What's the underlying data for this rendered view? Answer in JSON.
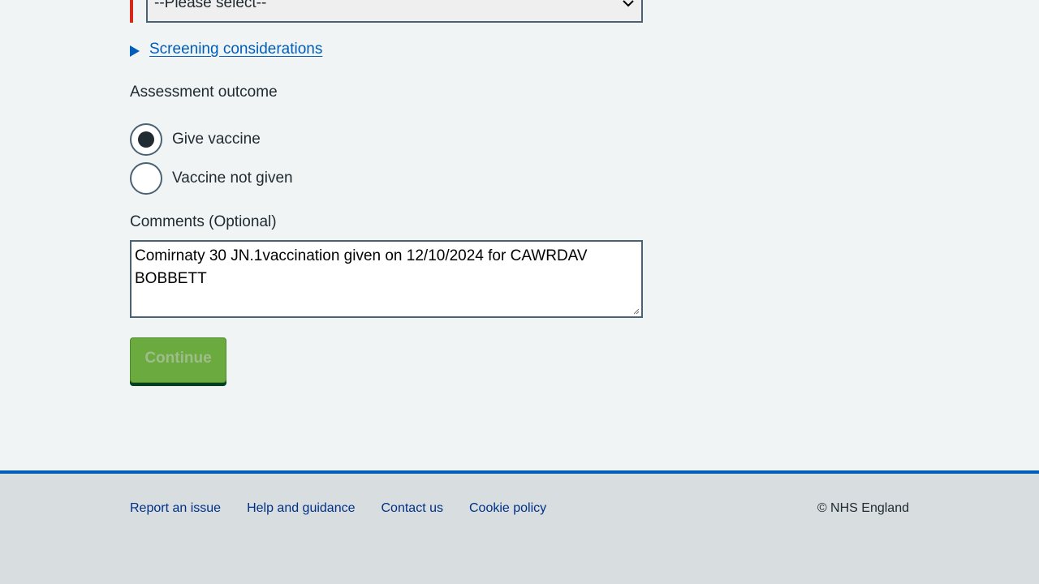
{
  "select": {
    "value": "--Please select--"
  },
  "details": {
    "summary": "Screening considerations"
  },
  "assessment": {
    "legend": "Assessment outcome",
    "options": [
      {
        "label": "Give vaccine",
        "checked": true
      },
      {
        "label": "Vaccine not given",
        "checked": false
      }
    ]
  },
  "comments": {
    "label": "Comments (Optional)",
    "value": "Comirnaty 30 JN.1vaccination given on 12/10/2024 for CAWRDAV BOBBETT"
  },
  "buttons": {
    "continue": "Continue"
  },
  "footer": {
    "links": [
      "Report an issue",
      "Help and guidance",
      "Contact us",
      "Cookie policy"
    ],
    "copyright": "© NHS England"
  },
  "colors": {
    "link": "#005eb8",
    "error": "#d5281b",
    "button": "#6aaa3f",
    "footer_border": "#005eb8"
  }
}
